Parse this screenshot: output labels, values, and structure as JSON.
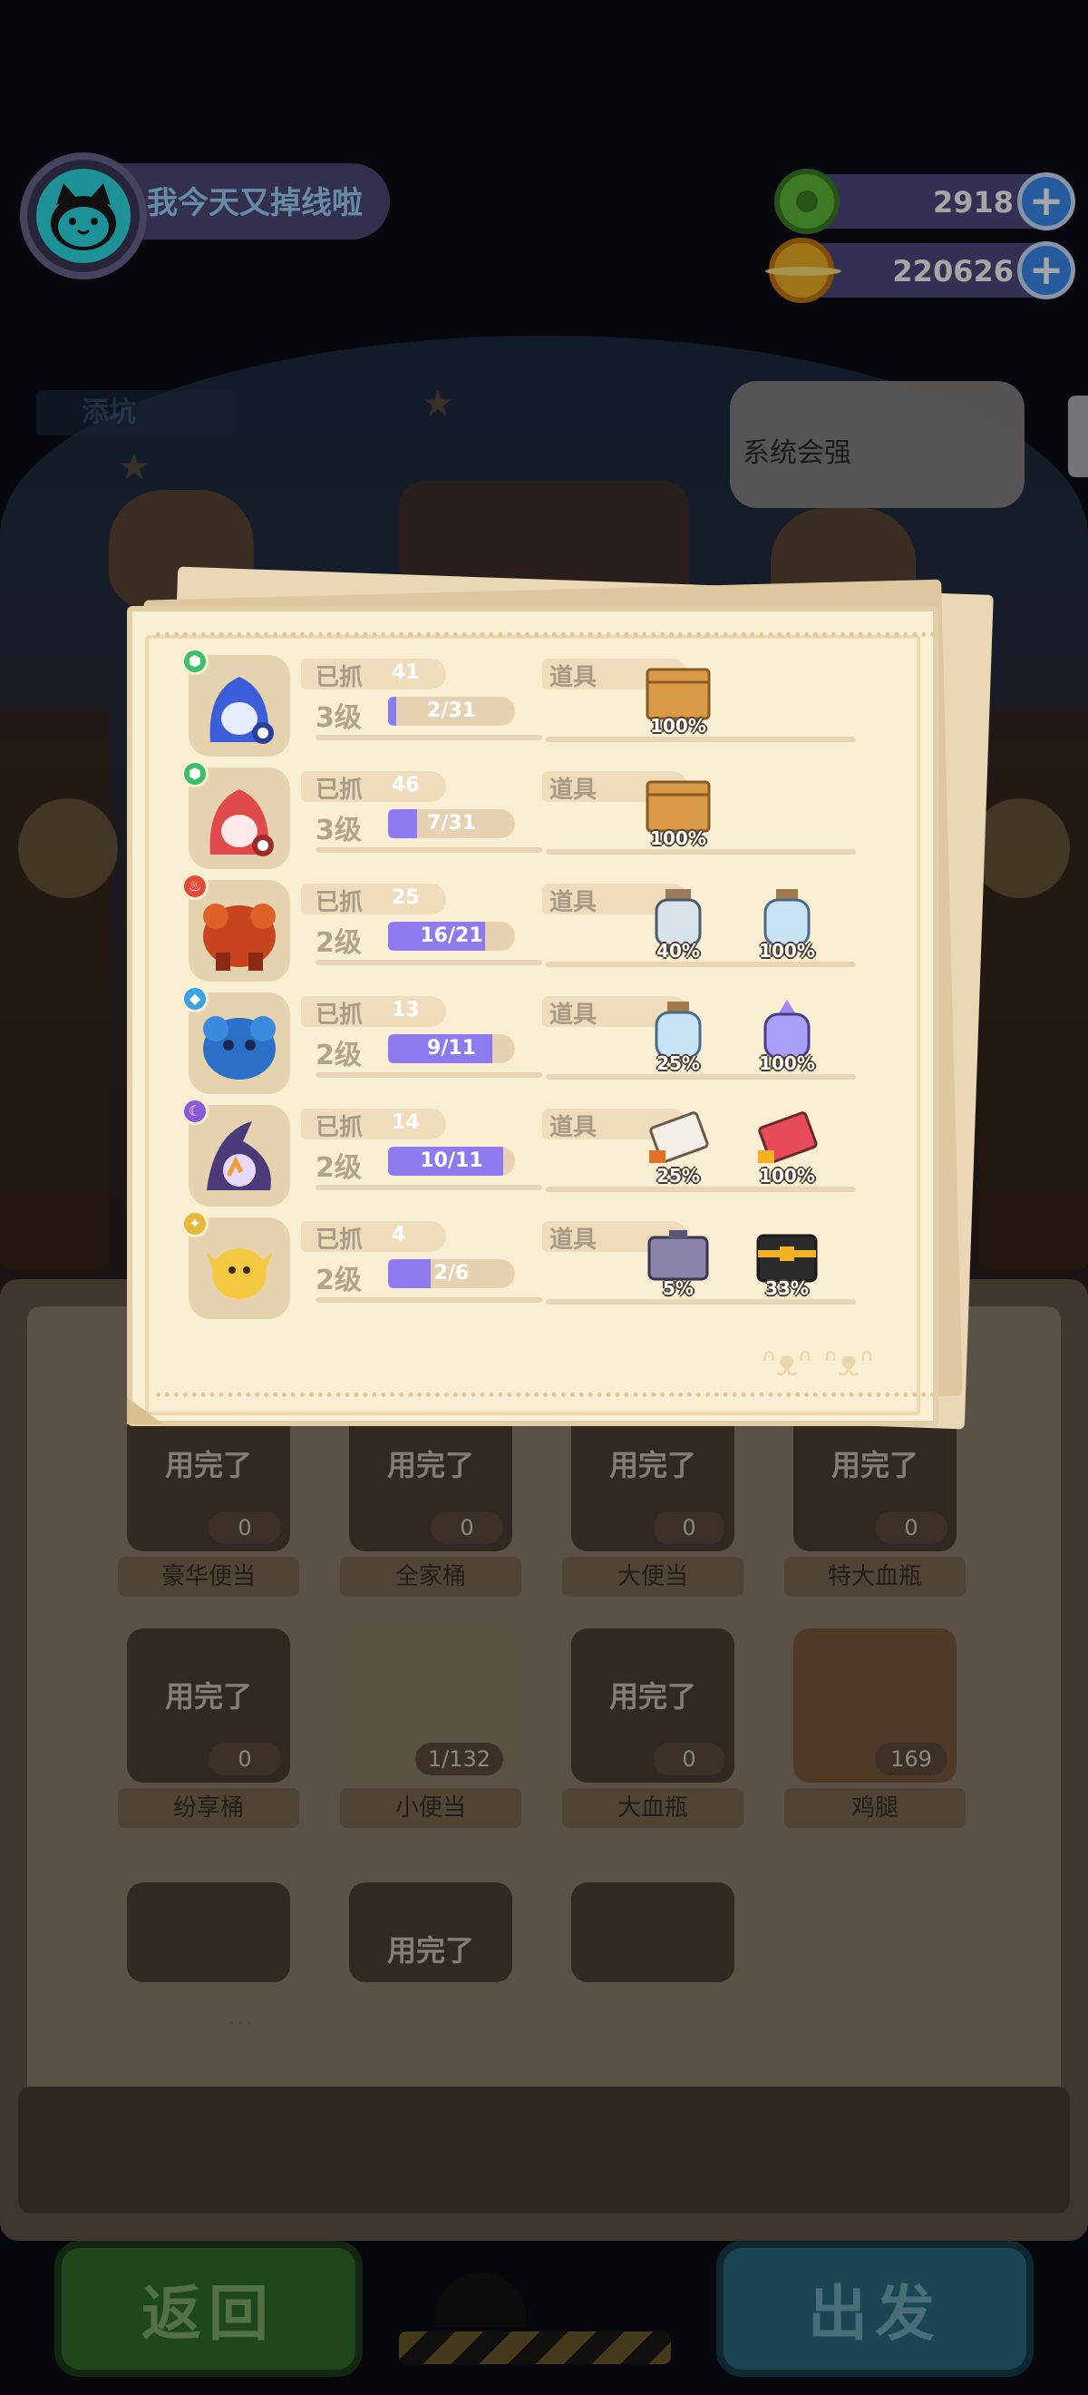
{
  "player": {
    "name": "我今天又掉线啦"
  },
  "currency": [
    {
      "icon": "green-donut-coin-icon",
      "value": "2918",
      "color": "#5fbf3a"
    },
    {
      "icon": "gold-planet-coin-icon",
      "value": "220626",
      "color": "#f2b224"
    }
  ],
  "tip": {
    "text": "系统会强"
  },
  "banner": {
    "text": "添坑"
  },
  "creatures": [
    {
      "icon": "blue-hooded-ghost-icon",
      "element_color": "#3bbf6a",
      "caught_label": "已抓",
      "caught": "41",
      "level": "3级",
      "progress_text": "2/31",
      "progress": 0.0645,
      "items_label": "道具",
      "items": [
        {
          "icon": "cardboard-box-icon",
          "pct": "100%"
        }
      ]
    },
    {
      "icon": "red-hooded-ghost-icon",
      "element_color": "#3bbf6a",
      "caught_label": "已抓",
      "caught": "46",
      "level": "3级",
      "progress_text": "7/31",
      "progress": 0.2258,
      "items_label": "道具",
      "items": [
        {
          "icon": "cardboard-box-icon",
          "pct": "100%"
        }
      ]
    },
    {
      "icon": "fire-golem-icon",
      "element_color": "#e84a3a",
      "caught_label": "已抓",
      "caught": "25",
      "level": "2级",
      "progress_text": "16/21",
      "progress": 0.7619,
      "items_label": "道具",
      "items": [
        {
          "icon": "milk-bottle-icon",
          "pct": "40%"
        },
        {
          "icon": "water-bottle-icon",
          "pct": "100%"
        }
      ]
    },
    {
      "icon": "water-golem-icon",
      "element_color": "#3aa3e8",
      "caught_label": "已抓",
      "caught": "13",
      "level": "2级",
      "progress_text": "9/11",
      "progress": 0.8182,
      "items_label": "道具",
      "items": [
        {
          "icon": "water-bottle-icon",
          "pct": "25%"
        },
        {
          "icon": "purple-potion-icon",
          "pct": "100%"
        }
      ]
    },
    {
      "icon": "purple-wizard-icon",
      "element_color": "#8a5ad8",
      "caught_label": "已抓",
      "caught": "14",
      "level": "2级",
      "progress_text": "10/11",
      "progress": 0.9091,
      "items_label": "道具",
      "items": [
        {
          "icon": "scroll-icon",
          "pct": "25%"
        },
        {
          "icon": "red-scroll-icon",
          "pct": "100%"
        }
      ]
    },
    {
      "icon": "yellow-bird-icon",
      "element_color": "#e8b83a",
      "caught_label": "已抓",
      "caught": "4",
      "level": "2级",
      "progress_text": "2/6",
      "progress": 0.3333,
      "items_label": "道具",
      "items": [
        {
          "icon": "purple-suitcase-icon",
          "pct": "5%"
        },
        {
          "icon": "gold-treasure-box-icon",
          "pct": "33%"
        }
      ]
    }
  ],
  "inventory": [
    {
      "name": "豪华便当",
      "status": "用完了",
      "count": "0"
    },
    {
      "name": "全家桶",
      "status": "用完了",
      "count": "0"
    },
    {
      "name": "大便当",
      "status": "用完了",
      "count": "0"
    },
    {
      "name": "特大血瓶",
      "status": "用完了",
      "count": "0"
    },
    {
      "name": "纷享桶",
      "status": "用完了",
      "count": "0"
    },
    {
      "name": "小便当",
      "status": "",
      "count": "1/132"
    },
    {
      "name": "大血瓶",
      "status": "用完了",
      "count": "0"
    },
    {
      "name": "鸡腿",
      "status": "",
      "count": "169"
    },
    {
      "name": "",
      "status": "",
      "count": ""
    },
    {
      "name": "",
      "status": "用完了",
      "count": ""
    },
    {
      "name": "",
      "status": "",
      "count": ""
    }
  ],
  "buttons": {
    "back": "返回",
    "go": "出发"
  }
}
